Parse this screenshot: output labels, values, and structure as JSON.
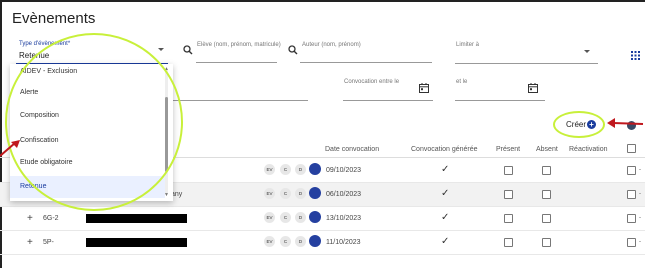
{
  "page": {
    "title": "Evènements"
  },
  "filters": {
    "type_label": "Type d'évènement*",
    "type_value": "Retenue",
    "eleve_placeholder": "Elève (nom, prénom, matricule)",
    "auteur_placeholder": "Auteur (nom, prénom)",
    "limiter_label": "Limiter à",
    "convocation_label": "Convocation entre le",
    "et_le_label": "et le"
  },
  "dropdown": {
    "items": [
      "AIDEV - Exclusion",
      "Alerte",
      "Composition",
      "Confiscation",
      "Etude obligatoire",
      "Retenue"
    ],
    "selected": "Retenue"
  },
  "toolbar": {
    "create_label": "Créer"
  },
  "table": {
    "headers": [
      "Date convocation",
      "Convocation générée",
      "Présent",
      "Absent",
      "Réactivation"
    ],
    "rows": [
      {
        "classe": "",
        "nom": "",
        "date": "09/10/2023",
        "generee": "✓"
      },
      {
        "classe": "",
        "nom": "any",
        "date": "06/10/2023",
        "generee": "✓"
      },
      {
        "classe": "6G-2",
        "nom": "",
        "date": "13/10/2023",
        "generee": "✓"
      },
      {
        "classe": "5P-",
        "nom": "",
        "date": "11/10/2023",
        "generee": "✓"
      }
    ],
    "pill_labels": [
      "EV",
      "C",
      "D"
    ]
  },
  "colors": {
    "accent": "#1a3c9e",
    "annotation": "#c8f03a",
    "arrow": "#c0181e"
  },
  "icons": [
    "search-icon",
    "calendar-icon",
    "grid-icon",
    "plus-circle-icon",
    "document-icon",
    "check-icon"
  ]
}
